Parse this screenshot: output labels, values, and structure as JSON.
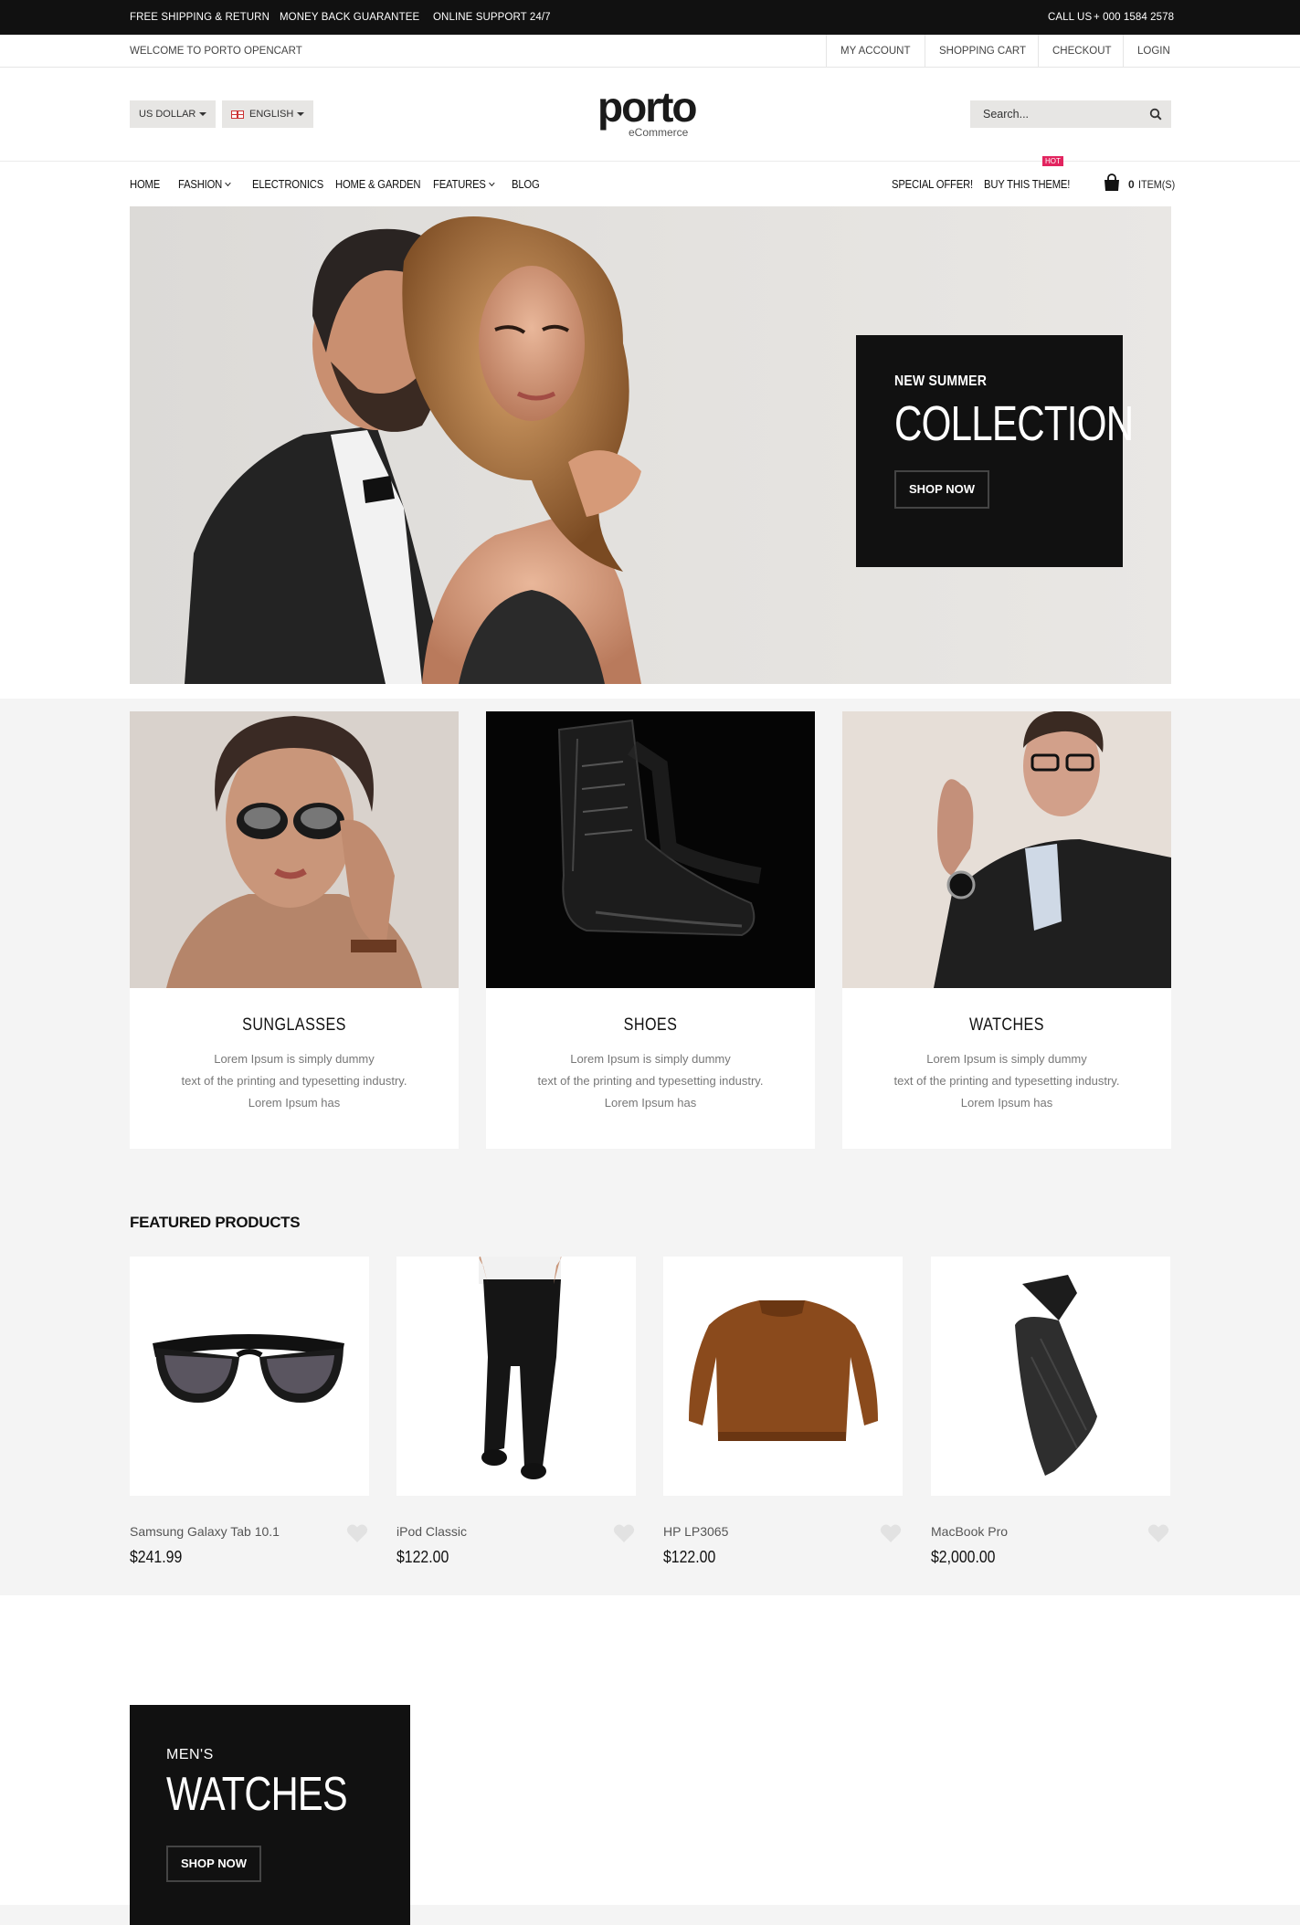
{
  "topbar": {
    "free_shipping": "FREE SHIPPING & RETURN",
    "money_back": "MONEY BACK GUARANTEE",
    "support": "ONLINE SUPPORT 24/7",
    "call_label": "CALL US",
    "phone": "+ 000 1584 2578"
  },
  "secbar": {
    "welcome": "WELCOME TO PORTO OPENCART",
    "links": [
      "MY ACCOUNT",
      "SHOPPING CART",
      "CHECKOUT",
      "LOGIN"
    ]
  },
  "header": {
    "currency": "US DOLLAR",
    "language": "ENGLISH",
    "logo_word": "porto",
    "logo_sub": "eCommerce",
    "search_placeholder": "Search..."
  },
  "nav": {
    "items": [
      "HOME",
      "FASHION",
      "ELECTRONICS",
      "HOME & GARDEN",
      "FEATURES",
      "BLOG"
    ],
    "special_offer": "SPECIAL OFFER!",
    "buy_theme": "BUY THIS THEME!",
    "hot_badge": "HOT",
    "cart_count": "0",
    "cart_label": "ITEM(S)"
  },
  "hero": {
    "subtitle": "NEW SUMMER",
    "title": "COLLECTION",
    "button": "SHOP NOW"
  },
  "categories": [
    {
      "title": "SUNGLASSES",
      "desc": [
        "Lorem Ipsum is simply dummy",
        "text of the printing and typesetting industry.",
        "Lorem Ipsum has"
      ]
    },
    {
      "title": "SHOES",
      "desc": [
        "Lorem Ipsum is simply dummy",
        "text of the printing and typesetting industry.",
        "Lorem Ipsum has"
      ]
    },
    {
      "title": "WATCHES",
      "desc": [
        "Lorem Ipsum is simply dummy",
        "text of the printing and typesetting industry.",
        "Lorem Ipsum has"
      ]
    }
  ],
  "featured": {
    "title": "FEATURED PRODUCTS",
    "products": [
      {
        "name": "Samsung Galaxy Tab 10.1",
        "price": "$241.99"
      },
      {
        "name": "iPod Classic",
        "price": "$122.00"
      },
      {
        "name": "HP LP3065",
        "price": "$122.00"
      },
      {
        "name": "MacBook Pro",
        "price": "$2,000.00"
      }
    ]
  },
  "promo": {
    "subtitle": "MEN'S",
    "title": "WATCHES",
    "button": "SHOP NOW"
  },
  "colors": {
    "dark": "#111111",
    "hot": "#e2245f",
    "gray_bg": "#f4f4f4"
  }
}
